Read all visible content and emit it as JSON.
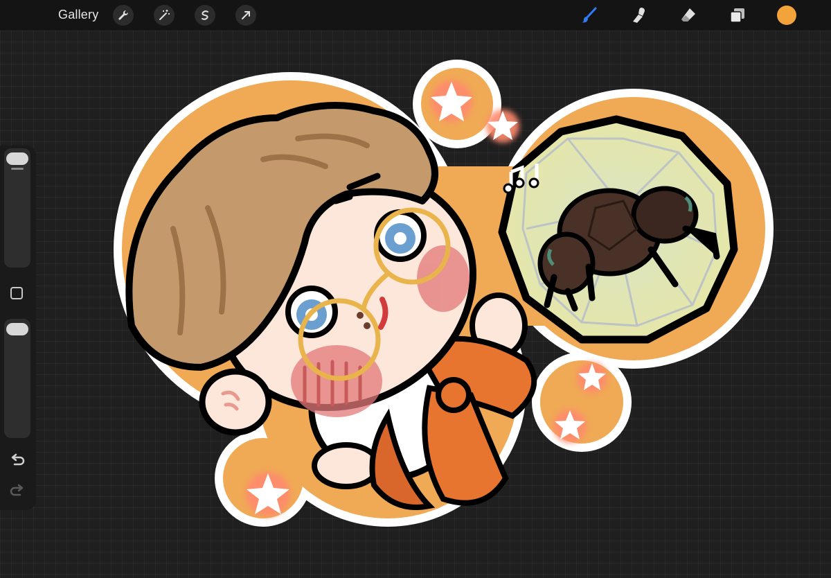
{
  "toolbar": {
    "gallery_label": "Gallery",
    "left_tools": [
      "wrench-icon",
      "magic-wand-icon",
      "selection-icon",
      "transform-arrow-icon"
    ],
    "right_tools": [
      "brush-icon",
      "smudge-icon",
      "eraser-icon",
      "layers-icon"
    ],
    "active_tool": "brush-icon",
    "current_color": "#f2a33a"
  },
  "side_panel": {
    "controls": [
      "brush-size-slider",
      "modify-button",
      "opacity-slider",
      "undo-icon",
      "redo-icon"
    ]
  },
  "colors": {
    "canvas_background": "#1f1f1f",
    "sticker_border": "#f0a955",
    "hair": "#c49a6c",
    "skin": "#fde6da",
    "glasses": "#e9b44b",
    "eyes": "#6a9fd0",
    "bow": "#e8752f",
    "bubble": "#dfe7c0"
  }
}
